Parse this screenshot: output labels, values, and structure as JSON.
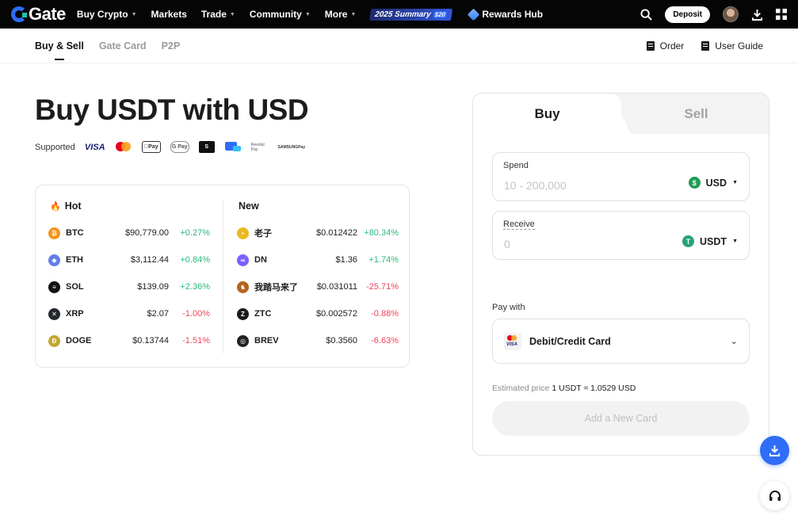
{
  "nav": {
    "logo": "Gate",
    "items": [
      {
        "label": "Buy Crypto",
        "dropdown": true
      },
      {
        "label": "Markets",
        "dropdown": false
      },
      {
        "label": "Trade",
        "dropdown": true
      },
      {
        "label": "Community",
        "dropdown": true
      },
      {
        "label": "More",
        "dropdown": true
      }
    ],
    "summary_banner": "2025 Summary",
    "summary_badge": "$20",
    "rewards": "Rewards Hub",
    "deposit": "Deposit",
    "icons": [
      "search-icon",
      "avatar",
      "download-icon",
      "grid-icon"
    ]
  },
  "subnav": {
    "tabs": [
      "Buy & Sell",
      "Gate Card",
      "P2P"
    ],
    "active": 0,
    "order": "Order",
    "guide": "User Guide"
  },
  "page": {
    "title": "Buy USDT with USD",
    "supported_label": "Supported",
    "payment_logos": [
      "VISA",
      "Mastercard",
      "Apple Pay",
      "Google Pay",
      "Skrill",
      "Bank",
      "Revolut Pay",
      "Samsung Pay"
    ],
    "payment_text": {
      "visa": "VISA",
      "applepay": "Pay",
      "gpay": "G Pay",
      "skrill": "S",
      "revolut": "Revolut Pay",
      "samsung_1": "SAMSUNG",
      "samsung_2": "Pay"
    }
  },
  "market": {
    "hot_title": "Hot",
    "new_title": "New",
    "hot": [
      {
        "symbol": "BTC",
        "price": "$90,779.00",
        "change": "+0.27%",
        "dir": "up",
        "color": "#f7931a",
        "glyph": "₿"
      },
      {
        "symbol": "ETH",
        "price": "$3,112.44",
        "change": "+0.84%",
        "dir": "up",
        "color": "#627eea",
        "glyph": "◆"
      },
      {
        "symbol": "SOL",
        "price": "$139.09",
        "change": "+2.36%",
        "dir": "up",
        "color": "#111111",
        "glyph": "≡"
      },
      {
        "symbol": "XRP",
        "price": "$2.07",
        "change": "-1.00%",
        "dir": "down",
        "color": "#23292f",
        "glyph": "✕"
      },
      {
        "symbol": "DOGE",
        "price": "$0.13744",
        "change": "-1.51%",
        "dir": "down",
        "color": "#c2a633",
        "glyph": "Ð"
      }
    ],
    "new": [
      {
        "symbol": "老子",
        "price": "$0.012422",
        "change": "+80.34%",
        "dir": "up",
        "color": "#e8b923",
        "glyph": "•"
      },
      {
        "symbol": "DN",
        "price": "$1.36",
        "change": "+1.74%",
        "dir": "up",
        "color": "#7b61ff",
        "glyph": "∞"
      },
      {
        "symbol": "我踏马来了",
        "price": "$0.031011",
        "change": "-25.71%",
        "dir": "down",
        "color": "#b5651d",
        "glyph": "♞"
      },
      {
        "symbol": "ZTC",
        "price": "$0.002572",
        "change": "-0.88%",
        "dir": "down",
        "color": "#1a1a1a",
        "glyph": "Z"
      },
      {
        "symbol": "BREV",
        "price": "$0.3560",
        "change": "-6.63%",
        "dir": "down",
        "color": "#222222",
        "glyph": "◎"
      }
    ]
  },
  "trade": {
    "tab_buy": "Buy",
    "tab_sell": "Sell",
    "spend_label": "Spend",
    "spend_placeholder": "10 - 200,000",
    "spend_currency": "USD",
    "receive_label": "Receive",
    "receive_placeholder": "0",
    "receive_currency": "USDT",
    "pay_with_label": "Pay with",
    "pay_method": "Debit/Credit Card",
    "card_icon_text": "VISA",
    "est_label": "Estimated price",
    "est_value": "1 USDT ≈ 1.0529 USD",
    "add_card": "Add a New Card"
  },
  "colors": {
    "brand_blue": "#2f6df6",
    "up": "#2bb87b",
    "down": "#f0445a"
  }
}
